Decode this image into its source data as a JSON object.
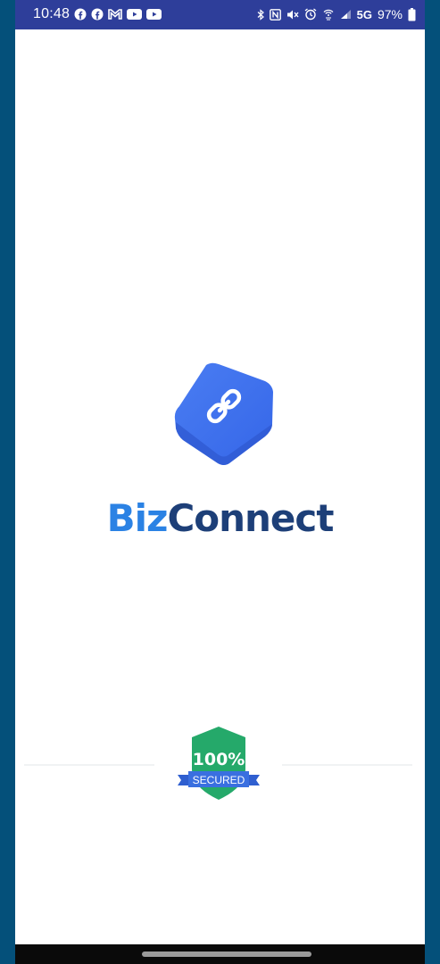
{
  "status_bar": {
    "time": "10:48",
    "left_icons": [
      "facebook-icon",
      "facebook-icon",
      "gmail-icon",
      "youtube-icon",
      "youtube-icon"
    ],
    "right_icons": [
      "bluetooth-icon",
      "nfc-icon",
      "mute-icon",
      "alarm-icon",
      "wifi-calling-icon",
      "signal-icon"
    ],
    "network": "5G",
    "battery": "97%"
  },
  "brand": {
    "part1": "Biz",
    "part2": "Connect",
    "color_part1": "#2b82e4",
    "color_part2": "#1d3f78",
    "logo_color": "#3d6ef0"
  },
  "security_badge": {
    "percent": "100%",
    "label": "SECURED",
    "shield_color": "#25a96a",
    "ribbon_color": "#3a6fe0"
  }
}
